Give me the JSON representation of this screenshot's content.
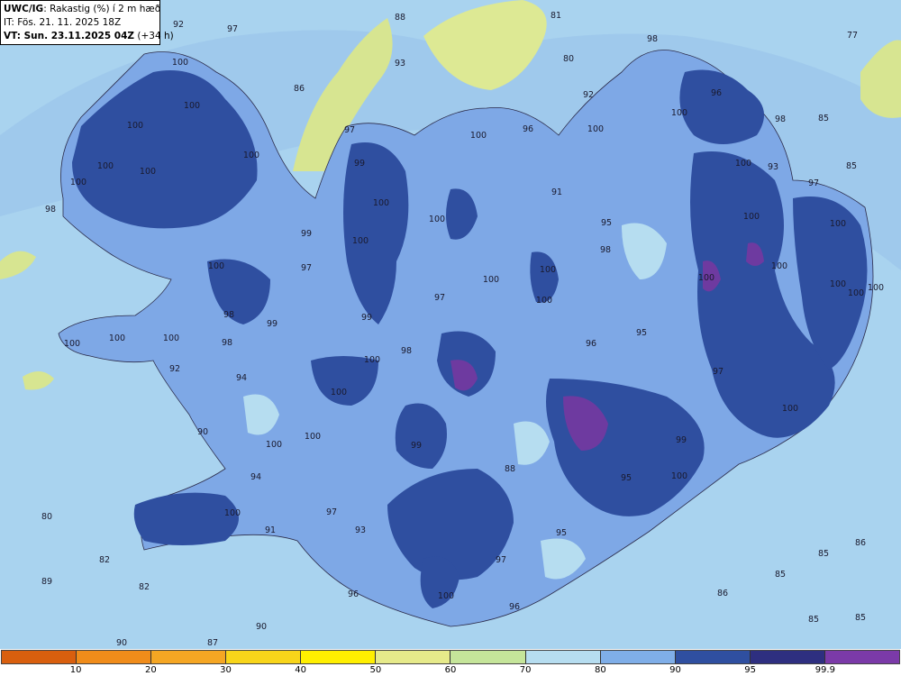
{
  "header": {
    "model": "UWC/IG",
    "variable": ": Rakastig (%) í 2 m hæð",
    "it_line": "IT: Fös. 21. 11. 2025 18Z",
    "vt_bold": "VT: Sun. 23.11.2025 04Z",
    "vt_offset": " (+34 h)"
  },
  "legend": {
    "colors": [
      "#d95f0e",
      "#f08c1a",
      "#f5a623",
      "#f8d51a",
      "#ffef00",
      "#e6ea8a",
      "#c5e59a",
      "#b6ddf0",
      "#7faee8",
      "#2f4fa0",
      "#2e2f80",
      "#7b3aa8"
    ],
    "ticks": [
      "10",
      "20",
      "30",
      "40",
      "50",
      "60",
      "70",
      "80",
      "90",
      "95",
      "99.9"
    ]
  },
  "map_labels": [
    {
      "t": "92"
    },
    {
      "t": "97"
    },
    {
      "t": "88"
    },
    {
      "t": "81"
    },
    {
      "t": "80"
    },
    {
      "t": "77"
    },
    {
      "t": "100"
    },
    {
      "t": "93"
    },
    {
      "t": "86"
    },
    {
      "t": "98"
    },
    {
      "t": "100"
    },
    {
      "t": "96"
    },
    {
      "t": "100"
    },
    {
      "t": "92"
    },
    {
      "t": "100"
    },
    {
      "t": "98"
    },
    {
      "t": "85"
    },
    {
      "t": "100"
    },
    {
      "t": "97"
    },
    {
      "t": "100"
    },
    {
      "t": "96"
    },
    {
      "t": "100"
    },
    {
      "t": "100"
    },
    {
      "t": "93"
    },
    {
      "t": "100"
    },
    {
      "t": "100"
    },
    {
      "t": "99"
    },
    {
      "t": "91"
    },
    {
      "t": "85"
    },
    {
      "t": "100"
    },
    {
      "t": "100"
    },
    {
      "t": "97"
    },
    {
      "t": "98"
    },
    {
      "t": "100"
    },
    {
      "t": "100"
    },
    {
      "t": "95"
    },
    {
      "t": "100"
    },
    {
      "t": "99"
    },
    {
      "t": "100"
    },
    {
      "t": "98"
    },
    {
      "t": "100"
    },
    {
      "t": "100"
    },
    {
      "t": "97"
    },
    {
      "t": "100"
    },
    {
      "t": "100"
    },
    {
      "t": "97"
    },
    {
      "t": "100"
    },
    {
      "t": "98"
    },
    {
      "t": "99"
    },
    {
      "t": "100"
    },
    {
      "t": "100"
    },
    {
      "t": "100"
    },
    {
      "t": "100"
    },
    {
      "t": "99"
    },
    {
      "t": "98"
    },
    {
      "t": "96"
    },
    {
      "t": "95"
    },
    {
      "t": "100"
    },
    {
      "t": "100"
    },
    {
      "t": "94"
    },
    {
      "t": "100"
    },
    {
      "t": "98"
    },
    {
      "t": "92"
    },
    {
      "t": "100"
    },
    {
      "t": "90"
    },
    {
      "t": "100"
    },
    {
      "t": "99"
    },
    {
      "t": "97"
    },
    {
      "t": "100"
    },
    {
      "t": "100"
    },
    {
      "t": "88"
    },
    {
      "t": "99"
    },
    {
      "t": "94"
    },
    {
      "t": "80"
    },
    {
      "t": "100"
    },
    {
      "t": "97"
    },
    {
      "t": "100"
    },
    {
      "t": "95"
    },
    {
      "t": "93"
    },
    {
      "t": "91"
    },
    {
      "t": "95"
    },
    {
      "t": "100"
    },
    {
      "t": "85"
    },
    {
      "t": "86"
    },
    {
      "t": "82"
    },
    {
      "t": "97"
    },
    {
      "t": "89"
    },
    {
      "t": "82"
    },
    {
      "t": "85"
    },
    {
      "t": "96"
    },
    {
      "t": "100"
    },
    {
      "t": "96"
    },
    {
      "t": "86"
    },
    {
      "t": "85"
    },
    {
      "t": "85"
    },
    {
      "t": "90"
    },
    {
      "t": "90"
    },
    {
      "t": "87"
    }
  ]
}
